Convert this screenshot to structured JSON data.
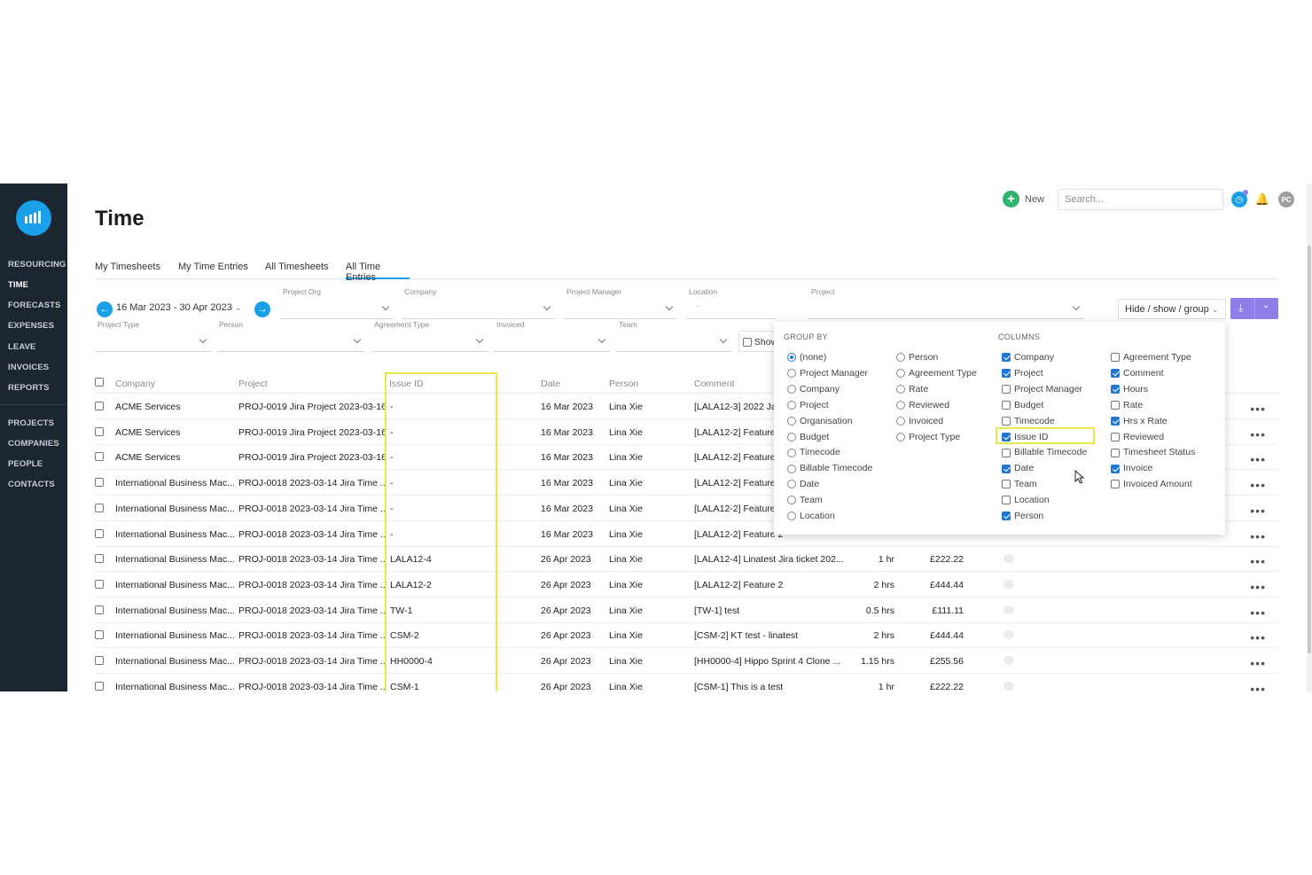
{
  "sidebar": {
    "items": [
      "RESOURCING",
      "TIME",
      "FORECASTS",
      "EXPENSES",
      "LEAVE",
      "INVOICES",
      "REPORTS",
      "PROJECTS",
      "COMPANIES",
      "PEOPLE",
      "CONTACTS"
    ]
  },
  "header": {
    "title": "Time",
    "new_label": "New",
    "search_placeholder": "Search...",
    "avatar": "PC"
  },
  "tabs": [
    "My Timesheets",
    "My Time Entries",
    "All Timesheets",
    "All Time Entries"
  ],
  "filters": {
    "date_range": "16 Mar 2023 - 30 Apr 2023",
    "project_org": "Project Org",
    "company": "Company",
    "project_manager": "Project Manager",
    "location": "Location",
    "location_value": "-",
    "project": "Project",
    "project_type": "Project Type",
    "person": "Person",
    "agreement_type": "Agreement Type",
    "invoiced": "Invoiced",
    "team": "Team",
    "show_label": "Show",
    "hide_show_group": "Hide / show / group"
  },
  "table": {
    "headers": [
      "Company",
      "Project",
      "Issue ID",
      "Date",
      "Person",
      "Comment"
    ],
    "rows": [
      {
        "company": "ACME Services",
        "project": "PROJ-0019  Jira Project 2023-03-16",
        "issue": "-",
        "date": "16 Mar 2023",
        "person": "Lina Xie",
        "comment": "[LALA12-3] 2022 Jar",
        "hours": "",
        "amount": ""
      },
      {
        "company": "ACME Services",
        "project": "PROJ-0019  Jira Project 2023-03-16",
        "issue": "-",
        "date": "16 Mar 2023",
        "person": "Lina Xie",
        "comment": "[LALA12-2] Feature",
        "hours": "",
        "amount": ""
      },
      {
        "company": "ACME Services",
        "project": "PROJ-0019  Jira Project 2023-03-16",
        "issue": "-",
        "date": "16 Mar 2023",
        "person": "Lina Xie",
        "comment": "[LALA12-2] Feature",
        "hours": "",
        "amount": ""
      },
      {
        "company": "International Business Mac...",
        "project": "PROJ-0018  2023-03-14 Jira Time ...",
        "issue": "-",
        "date": "16 Mar 2023",
        "person": "Lina Xie",
        "comment": "[LALA12-2] Feature",
        "hours": "",
        "amount": ""
      },
      {
        "company": "International Business Mac...",
        "project": "PROJ-0018  2023-03-14 Jira Time ...",
        "issue": "-",
        "date": "16 Mar 2023",
        "person": "Lina Xie",
        "comment": "[LALA12-2] Feature",
        "hours": "",
        "amount": ""
      },
      {
        "company": "International Business Mac...",
        "project": "PROJ-0018  2023-03-14 Jira Time ...",
        "issue": "-",
        "date": "16 Mar 2023",
        "person": "Lina Xie",
        "comment": "[LALA12-2] Feature 2",
        "hours": "",
        "amount": ""
      },
      {
        "company": "International Business Mac...",
        "project": "PROJ-0018  2023-03-14 Jira Time ...",
        "issue": "LALA12-4",
        "date": "26 Apr 2023",
        "person": "Lina Xie",
        "comment": "[LALA12-4] Linatest Jira ticket 202...",
        "hours": "1 hr",
        "amount": "£222.22"
      },
      {
        "company": "International Business Mac...",
        "project": "PROJ-0018  2023-03-14 Jira Time ...",
        "issue": "LALA12-2",
        "date": "26 Apr 2023",
        "person": "Lina Xie",
        "comment": "[LALA12-2] Feature 2",
        "hours": "2 hrs",
        "amount": "£444.44"
      },
      {
        "company": "International Business Mac...",
        "project": "PROJ-0018  2023-03-14 Jira Time ...",
        "issue": "TW-1",
        "date": "26 Apr 2023",
        "person": "Lina Xie",
        "comment": "[TW-1] test",
        "hours": "0.5 hrs",
        "amount": "£111.11"
      },
      {
        "company": "International Business Mac...",
        "project": "PROJ-0018  2023-03-14 Jira Time ...",
        "issue": "CSM-2",
        "date": "26 Apr 2023",
        "person": "Lina Xie",
        "comment": "[CSM-2] KT test - linatest",
        "hours": "2 hrs",
        "amount": "£444.44"
      },
      {
        "company": "International Business Mac...",
        "project": "PROJ-0018  2023-03-14 Jira Time ...",
        "issue": "HH0000-4",
        "date": "26 Apr 2023",
        "person": "Lina Xie",
        "comment": "[HH0000-4] Hippo Sprint 4 Clone ...",
        "hours": "1.15 hrs",
        "amount": "£255.56"
      },
      {
        "company": "International Business Mac...",
        "project": "PROJ-0018  2023-03-14 Jira Time ...",
        "issue": "CSM-1",
        "date": "26 Apr 2023",
        "person": "Lina Xie",
        "comment": "[CSM-1] This is a test",
        "hours": "1 hr",
        "amount": "£222.22"
      }
    ]
  },
  "panel": {
    "group_by_title": "GROUP BY",
    "columns_title": "COLUMNS",
    "group_by_col1": [
      {
        "label": "(none)",
        "on": true
      },
      {
        "label": "Project Manager",
        "on": false
      },
      {
        "label": "Company",
        "on": false
      },
      {
        "label": "Project",
        "on": false
      },
      {
        "label": "Organisation",
        "on": false
      },
      {
        "label": "Budget",
        "on": false
      },
      {
        "label": "Timecode",
        "on": false
      },
      {
        "label": "Billable Timecode",
        "on": false
      },
      {
        "label": "Date",
        "on": false
      },
      {
        "label": "Team",
        "on": false
      },
      {
        "label": "Location",
        "on": false
      }
    ],
    "group_by_col2": [
      {
        "label": "Person",
        "on": false
      },
      {
        "label": "Agreement Type",
        "on": false
      },
      {
        "label": "Rate",
        "on": false
      },
      {
        "label": "Reviewed",
        "on": false
      },
      {
        "label": "Invoiced",
        "on": false
      },
      {
        "label": "Project Type",
        "on": false
      }
    ],
    "columns_col1": [
      {
        "label": "Company",
        "on": true
      },
      {
        "label": "Project",
        "on": true
      },
      {
        "label": "Project Manager",
        "on": false
      },
      {
        "label": "Budget",
        "on": false
      },
      {
        "label": "Timecode",
        "on": false
      },
      {
        "label": "Issue ID",
        "on": true
      },
      {
        "label": "Billable Timecode",
        "on": false
      },
      {
        "label": "Date",
        "on": true
      },
      {
        "label": "Team",
        "on": false
      },
      {
        "label": "Location",
        "on": false
      },
      {
        "label": "Person",
        "on": true
      }
    ],
    "columns_col2": [
      {
        "label": "Agreement Type",
        "on": false
      },
      {
        "label": "Comment",
        "on": true
      },
      {
        "label": "Hours",
        "on": true
      },
      {
        "label": "Rate",
        "on": false
      },
      {
        "label": "Hrs x Rate",
        "on": true
      },
      {
        "label": "Reviewed",
        "on": false
      },
      {
        "label": "Timesheet Status",
        "on": false
      },
      {
        "label": "Invoice",
        "on": true
      },
      {
        "label": "Invoiced Amount",
        "on": false
      }
    ]
  },
  "colors": {
    "sidebar": "#1c2631",
    "accent": "#1aa0e8",
    "highlight": "#e6e84a",
    "download": "#8f7de8",
    "new": "#2fb36f"
  }
}
